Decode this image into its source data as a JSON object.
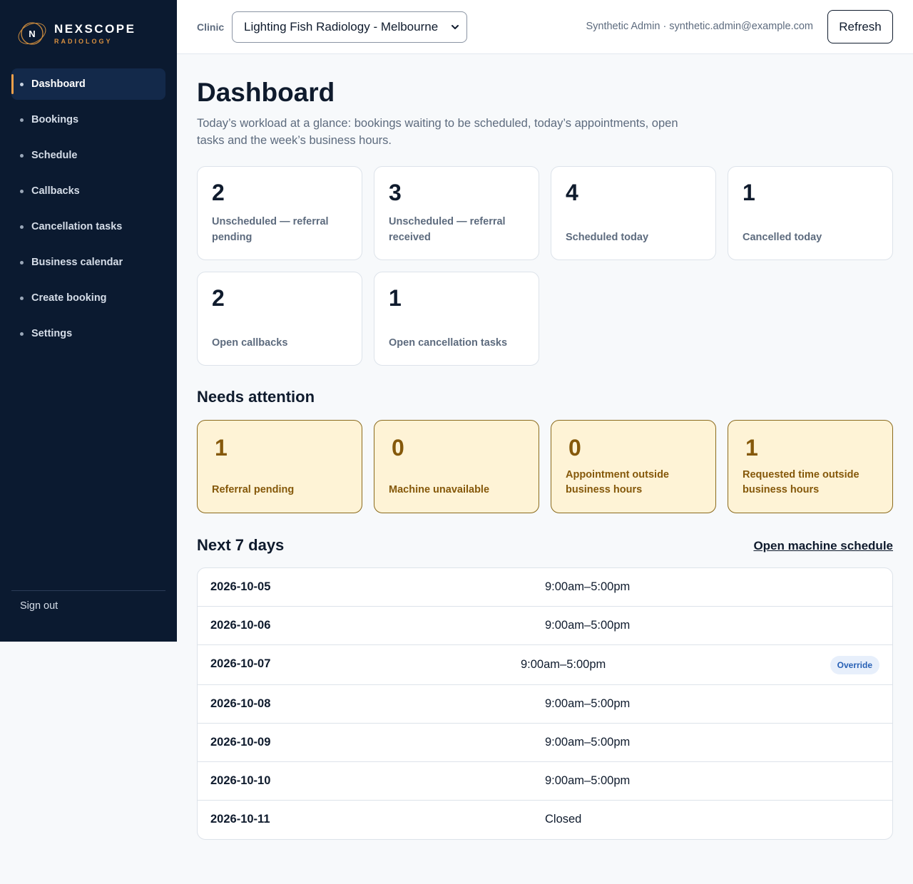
{
  "brand": {
    "name": "NEXSCOPE",
    "sub": "RADIOLOGY",
    "mark_letter": "N"
  },
  "sidebar": {
    "items": [
      {
        "label": "Dashboard",
        "active": true
      },
      {
        "label": "Bookings"
      },
      {
        "label": "Schedule"
      },
      {
        "label": "Callbacks"
      },
      {
        "label": "Cancellation tasks"
      },
      {
        "label": "Business calendar"
      },
      {
        "label": "Create booking"
      },
      {
        "label": "Settings"
      }
    ],
    "signout": "Sign out"
  },
  "header": {
    "clinic_label": "Clinic",
    "clinic_selected": "Lighting Fish Radiology - Melbourne",
    "user": "Synthetic Admin · synthetic.admin@example.com",
    "refresh_label": "Refresh"
  },
  "page": {
    "title": "Dashboard",
    "description": "Today’s workload at a glance: bookings waiting to be scheduled, today’s appointments, open tasks and the week’s business hours."
  },
  "stats": [
    {
      "value": "2",
      "label": "Unscheduled — referral pending"
    },
    {
      "value": "3",
      "label": "Unscheduled — referral received"
    },
    {
      "value": "4",
      "label": "Scheduled today"
    },
    {
      "value": "1",
      "label": "Cancelled today"
    },
    {
      "value": "2",
      "label": "Open callbacks"
    },
    {
      "value": "1",
      "label": "Open cancellation tasks"
    }
  ],
  "attention": {
    "title": "Needs attention",
    "items": [
      {
        "value": "1",
        "label": "Referral pending"
      },
      {
        "value": "0",
        "label": "Machine unavailable"
      },
      {
        "value": "0",
        "label": "Appointment outside business hours"
      },
      {
        "value": "1",
        "label": "Requested time outside business hours"
      }
    ]
  },
  "next_days": {
    "title": "Next 7 days",
    "link": "Open machine schedule",
    "rows": [
      {
        "date": "2026-10-05",
        "hours": "9:00am–5:00pm"
      },
      {
        "date": "2026-10-06",
        "hours": "9:00am–5:00pm"
      },
      {
        "date": "2026-10-07",
        "hours": "9:00am–5:00pm",
        "badge": "Override"
      },
      {
        "date": "2026-10-08",
        "hours": "9:00am–5:00pm"
      },
      {
        "date": "2026-10-09",
        "hours": "9:00am–5:00pm"
      },
      {
        "date": "2026-10-10",
        "hours": "9:00am–5:00pm"
      },
      {
        "date": "2026-10-11",
        "hours": "Closed"
      }
    ]
  },
  "colors": {
    "sidebar_bg": "#0b1a30",
    "accent": "#f0a04b",
    "warning_bg": "#fef3d6",
    "warning_text": "#85580a",
    "badge_bg": "#e7effb",
    "badge_text": "#2760b5"
  }
}
